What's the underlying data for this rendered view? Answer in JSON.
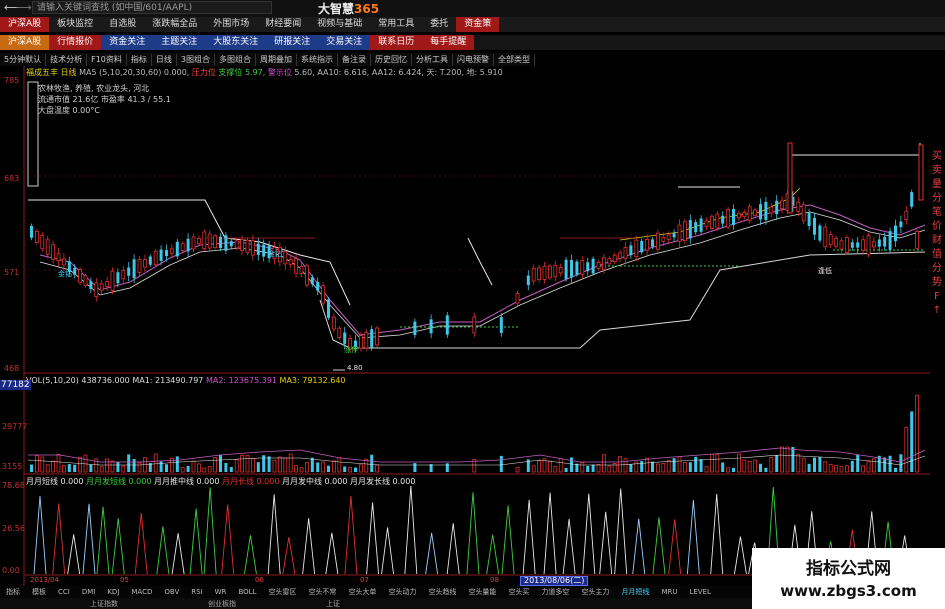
{
  "app": {
    "title": "大智慧",
    "title_num": "365",
    "search_placeholder": "请输入关键词查找 (如中国/601/AAPL)"
  },
  "menu1": [
    "沪深A股",
    "板块监控",
    "自选股",
    "涨跌幅全品",
    "外围市场",
    "财经要闻",
    "视频与基础",
    "常用工具",
    "委托",
    "资金策"
  ],
  "menu2": [
    "沪深A股",
    "行情报价",
    "资金关注",
    "主题关注",
    "大股东关注",
    "研报关注",
    "交易关注",
    "联系日历",
    "每手提醒"
  ],
  "toolbar": [
    "5分钟默认",
    "技术分析",
    "F10资料",
    "指标",
    "日线",
    "3图组合",
    "多图组合",
    "周期叠加",
    "系统指示",
    "备注录",
    "历史回忆",
    "分析工具",
    "闪电预警",
    "全部类型"
  ],
  "info": {
    "line1_a": "福成五丰 日线",
    "line1_ma": "MA5 (5,10,20,30,60)",
    "line1_b": "0.000,",
    "line1_c": "压力位",
    "line1_d": "支撑位 5.97,",
    "line1_e": "警示位",
    "line1_f": "5.60, AA10: 6.616, AA12: 6.424, 天: T.200, 地: 5.910",
    "block1": "农林牧渔, 养殖, 农业龙头, 河北",
    "block2": "流通市值 21.6亿    市盈率 41.3 / 55.1",
    "block3": "大盘温度 0.00°C"
  },
  "price_axis": [
    "785",
    "683",
    "571",
    "468"
  ],
  "low_label": "4.80",
  "labels": {
    "buy": "金钻",
    "buy2": "金钻",
    "rise": "涨停",
    "dip": "逢低"
  },
  "vol": {
    "a": "VOL(5,10,20)",
    "b": "438736.000",
    "c": "MA1: 213490.797",
    "d": "MA2: 123675.391",
    "e": "MA3: 79132.640",
    "axis_top": "77182",
    "axis_mid": "29777",
    "axis_low": "3155"
  },
  "indicator": {
    "a": "月月短线",
    "b": "0.000",
    "c": "月月发短线",
    "d": "0.000",
    "e": "月月推中线",
    "f": "0.000",
    "g": "月月长线",
    "h": "0.000",
    "i": "月月发中线",
    "j": "0.000",
    "k": "月月发长线",
    "l": "0.000",
    "axis_top": "78.68",
    "axis_mid": "26.56",
    "axis_low": "0.00"
  },
  "dates": [
    "2013/04",
    "05",
    "06",
    "07",
    "08"
  ],
  "date_selected": "2013/08/06(二)",
  "bottom_tabs": [
    "指标",
    "模板",
    "CCI",
    "DMI",
    "KDJ",
    "MACD",
    "OBV",
    "RSI",
    "WR",
    "BOLL",
    "空头雷区",
    "空头不常",
    "空头大单",
    "空头动力",
    "空头趋线",
    "空头量能",
    "空头买",
    "力道多空",
    "空头主力",
    "月月短线",
    "MRU",
    "LEVEL"
  ],
  "status": [
    "上证指数",
    "创业板指",
    "上证"
  ],
  "right_side": [
    "买",
    "卖",
    "量",
    "分",
    "笔",
    "价",
    "财",
    "值",
    "分",
    "势",
    "F",
    "↑"
  ],
  "watermark": {
    "title": "指标公式网",
    "url": "www.zbgs3.com"
  },
  "colors": {
    "up": "#e03030",
    "down": "#3ec8e8",
    "yellow": "#e6d200",
    "magenta": "#d050d0",
    "white": "#e8e8e8"
  }
}
